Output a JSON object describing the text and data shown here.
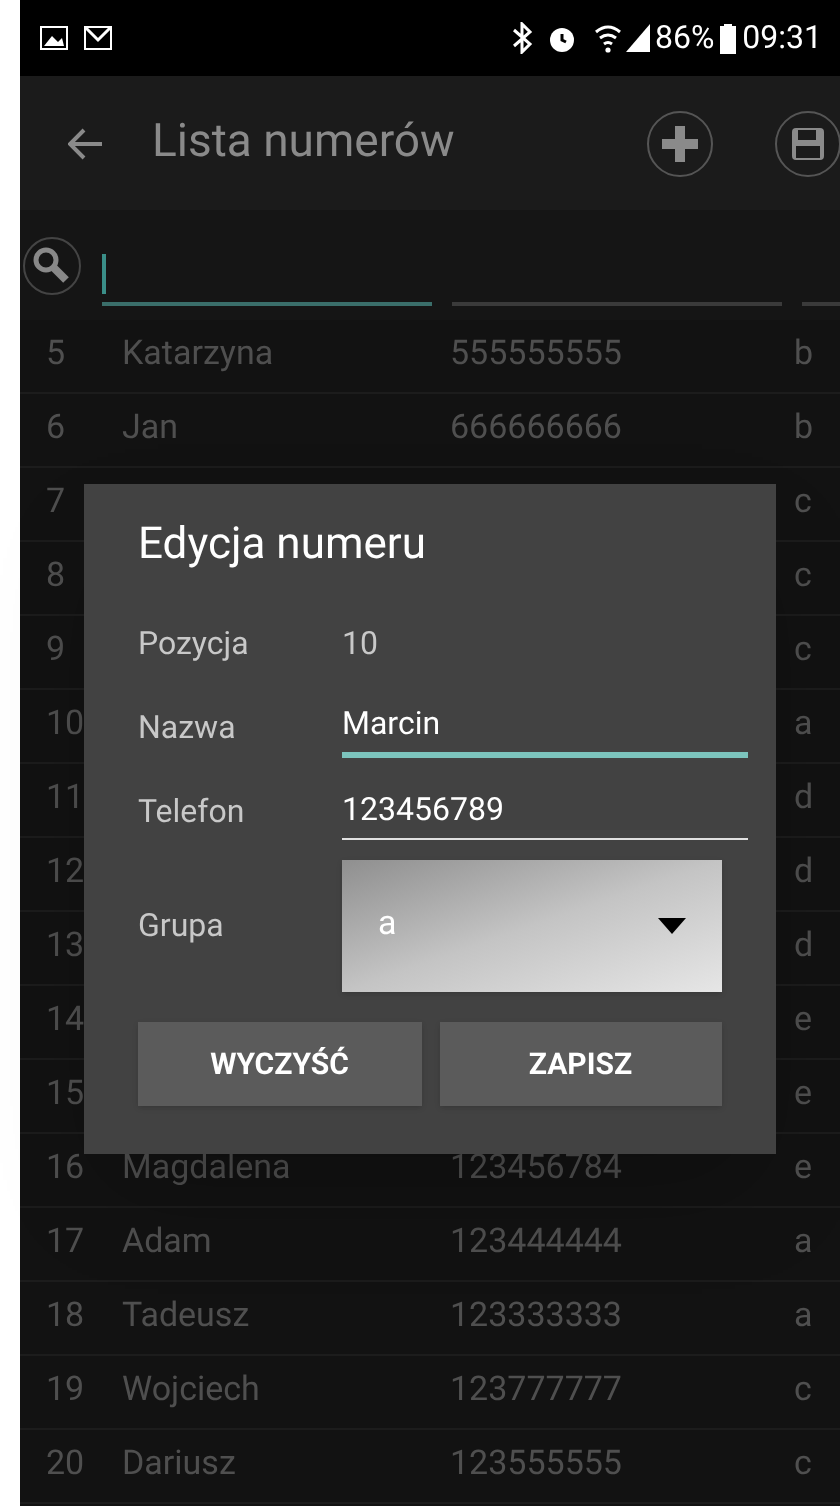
{
  "status_bar": {
    "battery": "86%",
    "time": "09:31"
  },
  "app_bar": {
    "title": "Lista numerów"
  },
  "search": {
    "fields": [
      {
        "focused": true
      },
      {
        "focused": false
      },
      {
        "focused": false
      }
    ]
  },
  "rows": [
    {
      "number": "5",
      "name": "Katarzyna",
      "phone": "555555555",
      "group": "b"
    },
    {
      "number": "6",
      "name": "Jan",
      "phone": "666666666",
      "group": "b"
    },
    {
      "number": "7",
      "group": "c"
    },
    {
      "number": "8",
      "group": "c"
    },
    {
      "number": "9",
      "group": "c"
    },
    {
      "number": "10",
      "group": "a"
    },
    {
      "number": "11",
      "group": "d"
    },
    {
      "number": "12",
      "group": "d"
    },
    {
      "number": "13",
      "group": "d"
    },
    {
      "number": "14",
      "group": "e"
    },
    {
      "number": "15",
      "group": "e"
    },
    {
      "number": "16",
      "name": "Magdalena",
      "phone": "123456784",
      "group": "e"
    },
    {
      "number": "17",
      "name": "Adam",
      "phone": "123444444",
      "group": "a"
    },
    {
      "number": "18",
      "name": "Tadeusz",
      "phone": "123333333",
      "group": "a"
    },
    {
      "number": "19",
      "name": "Wojciech",
      "phone": "123777777",
      "group": "c"
    },
    {
      "number": "20",
      "name": "Dariusz",
      "phone": "123555555",
      "group": "c"
    }
  ],
  "dialog": {
    "title": "Edycja numeru",
    "fields": [
      {
        "kind": "text",
        "label": "Pozycja",
        "value": "10"
      },
      {
        "kind": "input",
        "label": "Nazwa",
        "value": "Marcin",
        "focused": true
      },
      {
        "kind": "input",
        "label": "Telefon",
        "value": "123456789",
        "focused": false
      },
      {
        "kind": "select",
        "label": "Grupa",
        "value": "a"
      }
    ],
    "buttons": [
      "WYCZYŚĆ",
      "ZAPISZ"
    ]
  }
}
